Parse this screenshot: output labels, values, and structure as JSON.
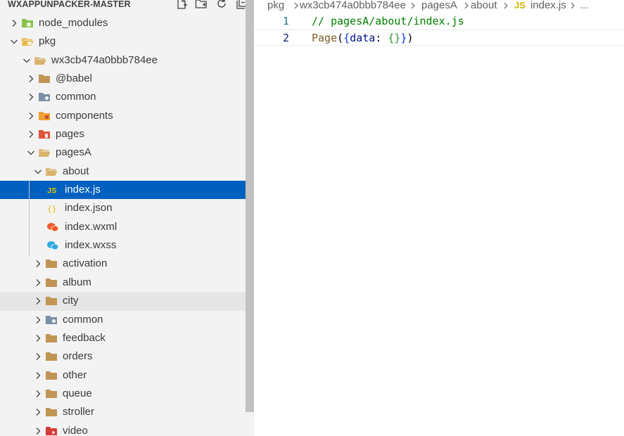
{
  "explorer": {
    "title": "WXAPPUNPACKER-MASTER",
    "actions": [
      {
        "name": "new-file-icon"
      },
      {
        "name": "new-folder-icon"
      },
      {
        "name": "refresh-icon"
      },
      {
        "name": "collapse-all-icon"
      }
    ],
    "tree": [
      {
        "label": "node_modules",
        "depth": 0,
        "type": "folder",
        "expanded": false,
        "icon": "node-folder-icon",
        "color": "#8bc34a"
      },
      {
        "label": "pkg",
        "depth": 0,
        "type": "folder",
        "expanded": true,
        "icon": "package-folder-open-icon",
        "color": "#e8b84a"
      },
      {
        "label": "wx3cb474a0bbb784ee",
        "depth": 1,
        "type": "folder",
        "expanded": true,
        "icon": "folder-open-icon",
        "color": "#d9b36b"
      },
      {
        "label": "@babel",
        "depth": 2,
        "type": "folder",
        "expanded": false,
        "icon": "folder-icon",
        "color": "#c09553"
      },
      {
        "label": "common",
        "depth": 2,
        "type": "folder",
        "expanded": false,
        "icon": "common-folder-icon",
        "color": "#7a8fa6"
      },
      {
        "label": "components",
        "depth": 2,
        "type": "folder",
        "expanded": false,
        "icon": "components-folder-icon",
        "color": "#f0a030"
      },
      {
        "label": "pages",
        "depth": 2,
        "type": "folder",
        "expanded": false,
        "icon": "pages-folder-icon",
        "color": "#e0533a"
      },
      {
        "label": "pagesA",
        "depth": 2,
        "type": "folder",
        "expanded": true,
        "icon": "folder-open-icon",
        "color": "#d9b36b"
      },
      {
        "label": "about",
        "depth": 3,
        "type": "folder",
        "expanded": true,
        "icon": "folder-open-icon",
        "color": "#d9b36b"
      },
      {
        "label": "index.js",
        "depth": 4,
        "type": "file",
        "icon": "js-file-icon",
        "glyph": "JS",
        "color": "#e8c100",
        "selected": true
      },
      {
        "label": "index.json",
        "depth": 4,
        "type": "file",
        "icon": "json-file-icon",
        "glyph": "{ }",
        "color": "#e8b900"
      },
      {
        "label": "index.wxml",
        "depth": 4,
        "type": "file",
        "icon": "wxml-file-icon",
        "color": "#f05a28"
      },
      {
        "label": "index.wxss",
        "depth": 4,
        "type": "file",
        "icon": "wxss-file-icon",
        "color": "#2fa8e0"
      },
      {
        "label": "activation",
        "depth": 3,
        "type": "folder",
        "expanded": false,
        "icon": "folder-icon",
        "color": "#c09553"
      },
      {
        "label": "album",
        "depth": 3,
        "type": "folder",
        "expanded": false,
        "icon": "folder-icon",
        "color": "#c09553"
      },
      {
        "label": "city",
        "depth": 3,
        "type": "folder",
        "expanded": false,
        "icon": "folder-icon",
        "color": "#c09553",
        "hover": true
      },
      {
        "label": "common",
        "depth": 3,
        "type": "folder",
        "expanded": false,
        "icon": "common-folder-icon",
        "color": "#7a8fa6"
      },
      {
        "label": "feedback",
        "depth": 3,
        "type": "folder",
        "expanded": false,
        "icon": "folder-icon",
        "color": "#c09553"
      },
      {
        "label": "orders",
        "depth": 3,
        "type": "folder",
        "expanded": false,
        "icon": "folder-icon",
        "color": "#c09553"
      },
      {
        "label": "other",
        "depth": 3,
        "type": "folder",
        "expanded": false,
        "icon": "folder-icon",
        "color": "#c09553"
      },
      {
        "label": "queue",
        "depth": 3,
        "type": "folder",
        "expanded": false,
        "icon": "folder-icon",
        "color": "#c09553"
      },
      {
        "label": "stroller",
        "depth": 3,
        "type": "folder",
        "expanded": false,
        "icon": "folder-icon",
        "color": "#c09553"
      },
      {
        "label": "video",
        "depth": 3,
        "type": "folder",
        "expanded": false,
        "icon": "video-folder-icon",
        "color": "#d63a3a"
      }
    ]
  },
  "breadcrumb": {
    "items": [
      "pkg",
      "wx3cb474a0bbb784ee",
      "pagesA",
      "about"
    ],
    "file_badge": "JS",
    "file": "index.js",
    "more": "..."
  },
  "editor": {
    "lines": [
      {
        "number": "1",
        "tokens": [
          {
            "t": "// pagesA/about/index.js",
            "k": "comment"
          }
        ]
      },
      {
        "number": "2",
        "tokens": [
          {
            "t": "Page",
            "k": "ident"
          },
          {
            "t": "(",
            "k": "punc"
          },
          {
            "t": "{",
            "k": "brace"
          },
          {
            "t": "data",
            "k": "prop"
          },
          {
            "t": ": ",
            "k": "punc"
          },
          {
            "t": "{}",
            "k": "brace2"
          },
          {
            "t": "}",
            "k": "brace"
          },
          {
            "t": ")",
            "k": "punc"
          }
        ],
        "current": true
      }
    ]
  },
  "colors": {
    "selection": "#0060c0",
    "sidebar_bg": "#f3f3f3",
    "line_number": "#237893"
  }
}
